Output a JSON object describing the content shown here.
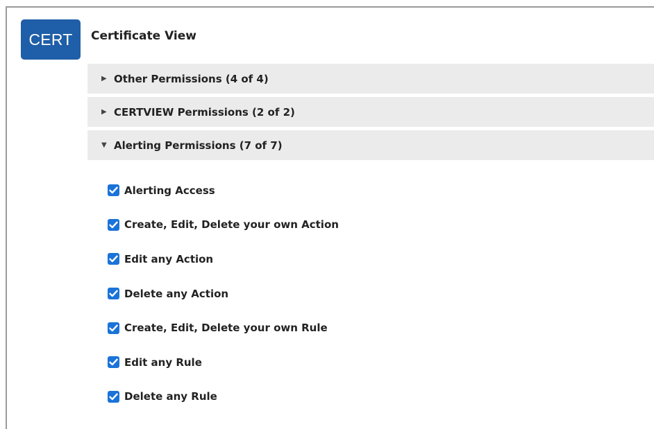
{
  "app": {
    "badge_text": "CERT",
    "title": "Certificate View"
  },
  "groups": [
    {
      "label": "Other Permissions (4 of 4)",
      "expanded": false,
      "caret": "▶"
    },
    {
      "label": "CERTVIEW Permissions (2 of 2)",
      "expanded": false,
      "caret": "▶"
    },
    {
      "label": "Alerting Permissions (7 of 7)",
      "expanded": true,
      "caret": "▼"
    }
  ],
  "permissions": [
    {
      "label": "Alerting Access",
      "checked": true
    },
    {
      "label": "Create, Edit, Delete your own Action",
      "checked": true
    },
    {
      "label": "Edit any Action",
      "checked": true
    },
    {
      "label": "Delete any Action",
      "checked": true
    },
    {
      "label": "Create, Edit, Delete your own Rule",
      "checked": true
    },
    {
      "label": "Edit any Rule",
      "checked": true
    },
    {
      "label": "Delete any Rule",
      "checked": true
    }
  ],
  "colors": {
    "badge": "#1f5ea8",
    "checkbox": "#1a73d9",
    "group_header_bg": "#ebebeb"
  }
}
